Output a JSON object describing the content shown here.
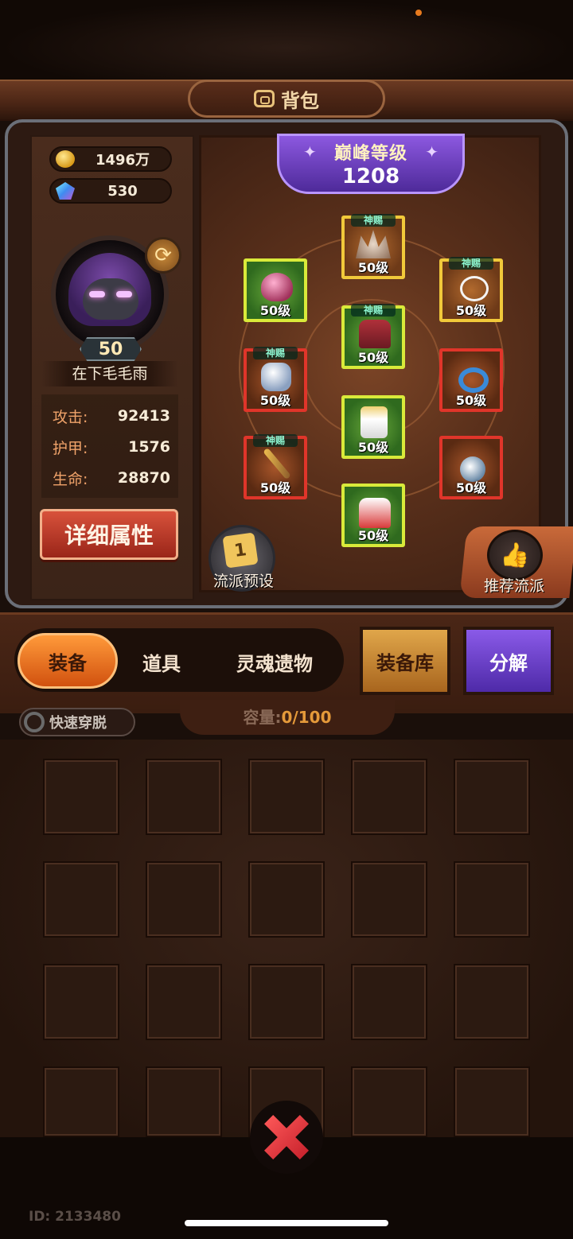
{
  "header": {
    "title": "背包"
  },
  "currency": {
    "gold": "1496万",
    "gems": "530"
  },
  "hero": {
    "level": "50",
    "name": "在下毛毛雨"
  },
  "stats": [
    {
      "label": "攻击:",
      "value": "92413"
    },
    {
      "label": "护甲:",
      "value": "1576"
    },
    {
      "label": "生命:",
      "value": "28870"
    }
  ],
  "detail_button": "详细属性",
  "peak": {
    "label": "巅峰等级",
    "value": "1208"
  },
  "equipment": [
    {
      "name": "crown",
      "level": "50级",
      "gift": "神赐",
      "rarity": "gold"
    },
    {
      "name": "shoulder",
      "level": "50级",
      "gift": "",
      "rarity": "green"
    },
    {
      "name": "necklace",
      "level": "50级",
      "gift": "神赐",
      "rarity": "gold"
    },
    {
      "name": "armor",
      "level": "50级",
      "gift": "神赐",
      "rarity": "green"
    },
    {
      "name": "gauntlet",
      "level": "50级",
      "gift": "神赐",
      "rarity": "red"
    },
    {
      "name": "ring",
      "level": "50级",
      "gift": "",
      "rarity": "red"
    },
    {
      "name": "pants",
      "level": "50级",
      "gift": "",
      "rarity": "green"
    },
    {
      "name": "staff",
      "level": "50级",
      "gift": "神赐",
      "rarity": "red"
    },
    {
      "name": "pouch",
      "level": "50级",
      "gift": "",
      "rarity": "red"
    },
    {
      "name": "boots",
      "level": "50级",
      "gift": "",
      "rarity": "green"
    }
  ],
  "build_preset": {
    "label": "流派预设",
    "icon_text": "1"
  },
  "recommend": {
    "label": "推荐流派"
  },
  "tabs": {
    "equipment": "装备",
    "items": "道具",
    "soul_relics": "灵魂遗物"
  },
  "vault_button": "装备库",
  "decompose_button": "分解",
  "quick_toggle": "快速穿脱",
  "capacity": {
    "label": "容量:",
    "value": "0/100"
  },
  "footer": {
    "id_text": "ID: 2133480"
  },
  "colors": {
    "accent": "#e77a1e",
    "status_dot": "#e77a1e"
  }
}
